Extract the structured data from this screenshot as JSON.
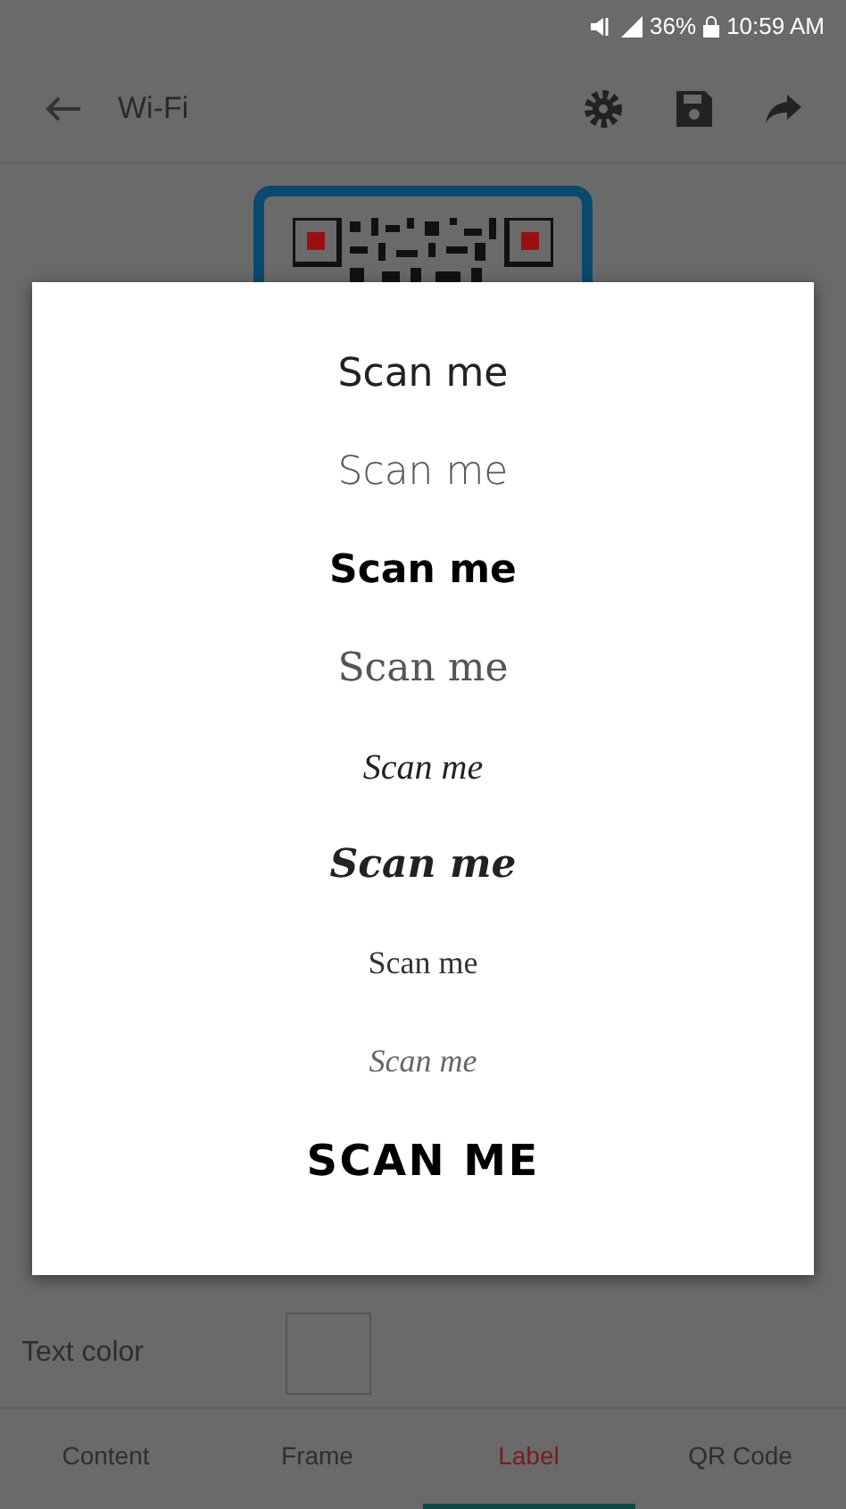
{
  "status_bar": {
    "battery": "36%",
    "time": "10:59 AM"
  },
  "app_bar": {
    "title": "Wi-Fi"
  },
  "font_dialog": {
    "options": [
      {
        "label": "Scan me",
        "kind": "sans"
      },
      {
        "label": "Scan me",
        "kind": "light"
      },
      {
        "label": "Scan me",
        "kind": "bold"
      },
      {
        "label": "Scan me",
        "kind": "serif"
      },
      {
        "label": "Scan me",
        "kind": "script"
      },
      {
        "label": "Scan me",
        "kind": "bolditalic"
      },
      {
        "label": "Scan me",
        "kind": "smallserif"
      },
      {
        "label": "Scan me",
        "kind": "thinitalic"
      },
      {
        "label": "SCAN ME",
        "kind": "display"
      }
    ]
  },
  "text_color": {
    "label": "Text color"
  },
  "tabs": [
    {
      "label": "Content",
      "selected": false
    },
    {
      "label": "Frame",
      "selected": false
    },
    {
      "label": "Label",
      "selected": true
    },
    {
      "label": "QR Code",
      "selected": false
    }
  ]
}
